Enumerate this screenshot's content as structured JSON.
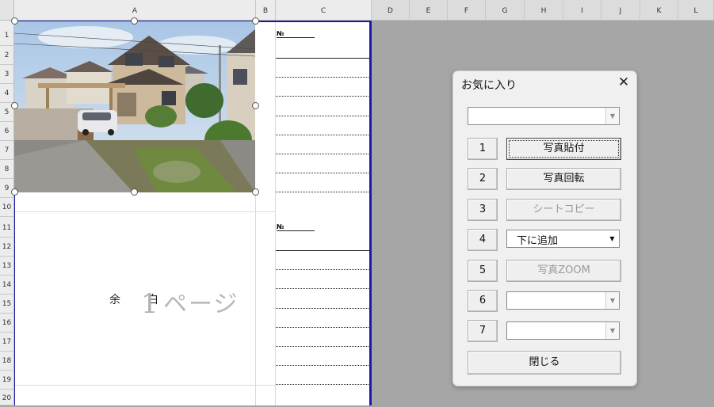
{
  "spreadsheet": {
    "columns": [
      "A",
      "B",
      "C",
      "D",
      "E",
      "F",
      "G",
      "H",
      "I",
      "J",
      "K",
      "L"
    ],
    "rows": [
      "1",
      "2",
      "3",
      "4",
      "5",
      "6",
      "7",
      "8",
      "9",
      "10",
      "11",
      "12",
      "13",
      "14",
      "15",
      "16",
      "17",
      "18",
      "19",
      "20"
    ],
    "no_label_1": "№",
    "no_label_2": "№",
    "margin_label_left": "余",
    "margin_label_right": "白",
    "page_number": "1",
    "page_label": "ページ"
  },
  "dialog": {
    "title": "お気に入り",
    "close_glyph": "✕",
    "top_combo_value": "",
    "numbers": [
      "1",
      "2",
      "3",
      "4",
      "5",
      "6",
      "7"
    ],
    "actions": {
      "paste_photo": "写真貼付",
      "rotate_photo": "写真回転",
      "copy_sheet": "シートコピー",
      "insert_below": "下に追加",
      "photo_zoom": "写真ZOOM",
      "close": "閉じる"
    },
    "combo6_value": "",
    "combo7_value": "",
    "dropdown_arrow": "▼"
  },
  "colors": {
    "frame_blue": "#1a1aa8",
    "workspace_gray": "#a6a6a6"
  }
}
